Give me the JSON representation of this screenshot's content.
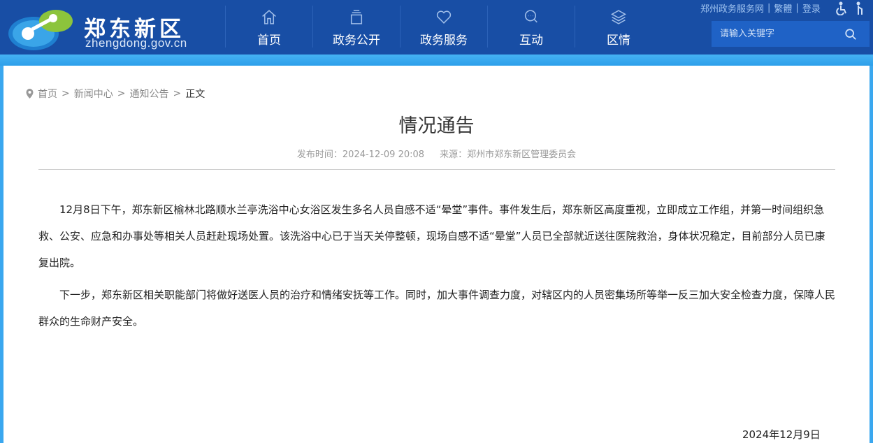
{
  "header": {
    "logo_title": "郑东新区",
    "logo_sub": "zhengdong.gov.cn",
    "nav": [
      {
        "label": "首页",
        "icon": "home-icon"
      },
      {
        "label": "政务公开",
        "icon": "folder-icon"
      },
      {
        "label": "政务服务",
        "icon": "heart-icon"
      },
      {
        "label": "互动",
        "icon": "chat-icon"
      },
      {
        "label": "区情",
        "icon": "layers-icon"
      }
    ],
    "top_links": [
      "郑州政务服务网",
      "繁體",
      "登录"
    ],
    "search_placeholder": "请输入关键字"
  },
  "breadcrumb": [
    "首页",
    "新闻中心",
    "通知公告",
    "正文"
  ],
  "article": {
    "title": "情况通告",
    "publish_time": "发布时间：2024-12-09 20:08",
    "source": "来源：郑州市郑东新区管理委员会",
    "paragraphs": [
      "12月8日下午，郑东新区榆林北路顺水兰亭洗浴中心女浴区发生多名人员自感不适“晕堂”事件。事件发生后，郑东新区高度重视，立即成立工作组，并第一时间组织急救、公安、应急和办事处等相关人员赶赴现场处置。该洗浴中心已于当天关停整顿，现场自感不适“晕堂”人员已全部就近送往医院救治，身体状况稳定，目前部分人员已康复出院。",
      "下一步，郑东新区相关职能部门将做好送医人员的治疗和情绪安抚等工作。同时，加大事件调查力度，对辖区内的人员密集场所等举一反三加大安全检查力度，保障人民群众的生命财产安全。"
    ],
    "date": "2024年12月9日"
  }
}
